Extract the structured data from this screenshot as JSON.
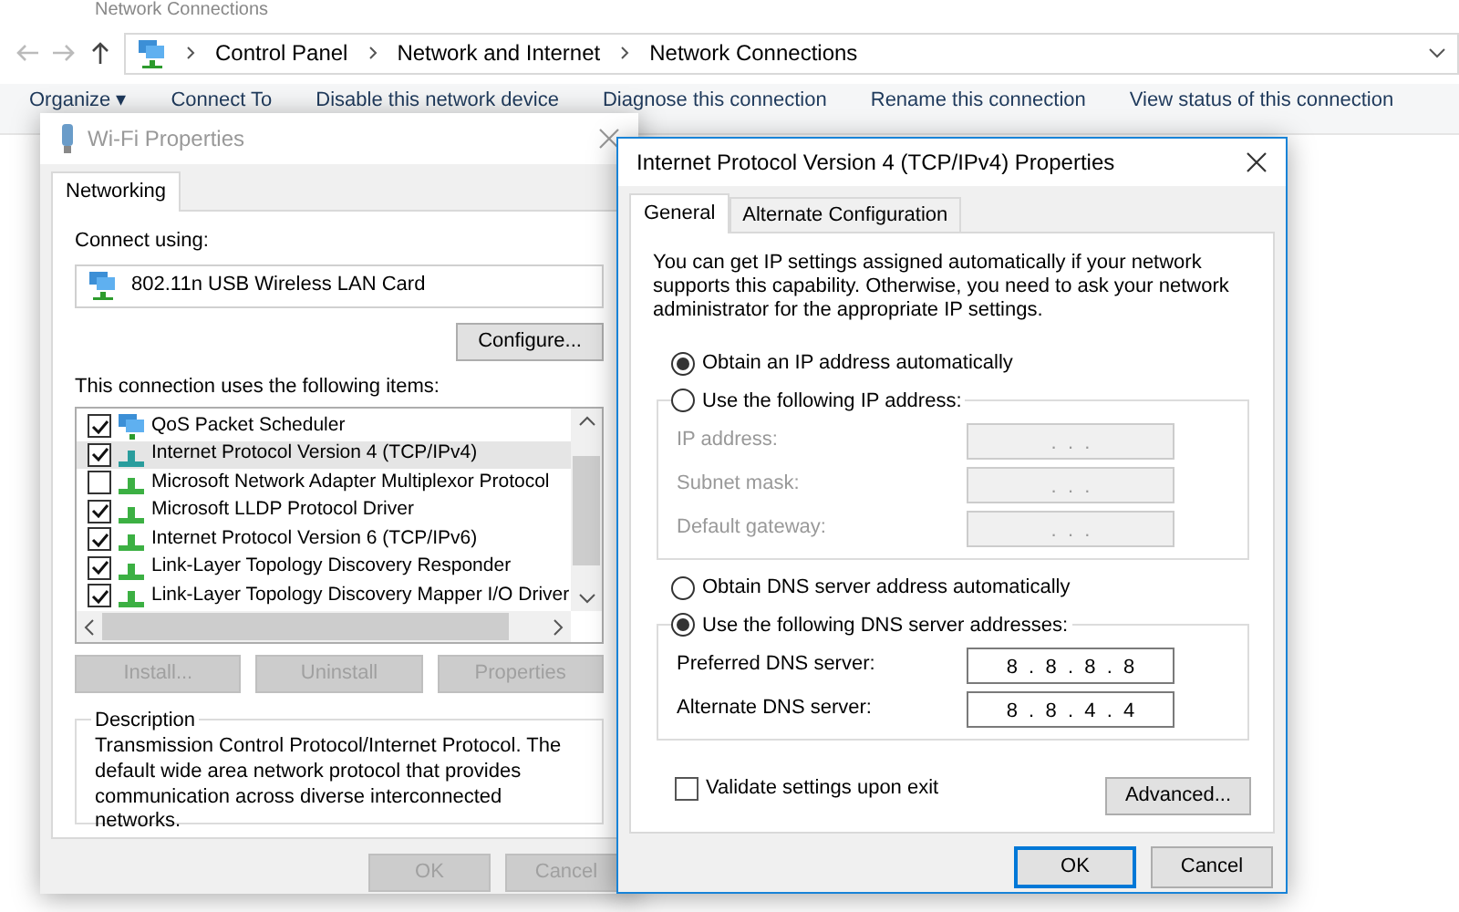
{
  "explorer": {
    "title": "Network Connections",
    "breadcrumb": [
      "Control Panel",
      "Network and Internet",
      "Network Connections"
    ],
    "toolbar": [
      "Organize ▾",
      "Connect To",
      "Disable this network device",
      "Diagnose this connection",
      "Rename this connection",
      "View status of this connection"
    ]
  },
  "wifi_dialog": {
    "title": "Wi-Fi Properties",
    "active": false,
    "tabs": [
      {
        "label": "Networking",
        "selected": true
      }
    ],
    "connect_using_label": "Connect using:",
    "adapter": "802.11n USB Wireless LAN Card",
    "configure_button": "Configure...",
    "items_label": "This connection uses the following items:",
    "items": [
      {
        "label": "QoS Packet Scheduler",
        "checked": true,
        "selected": false,
        "kind": "service"
      },
      {
        "label": "Internet Protocol Version 4 (TCP/IPv4)",
        "checked": true,
        "selected": true,
        "kind": "protocol"
      },
      {
        "label": "Microsoft Network Adapter Multiplexor Protocol",
        "checked": false,
        "selected": false,
        "kind": "protocol"
      },
      {
        "label": "Microsoft LLDP Protocol Driver",
        "checked": true,
        "selected": false,
        "kind": "protocol"
      },
      {
        "label": "Internet Protocol Version 6 (TCP/IPv6)",
        "checked": true,
        "selected": false,
        "kind": "protocol"
      },
      {
        "label": "Link-Layer Topology Discovery Responder",
        "checked": true,
        "selected": false,
        "kind": "protocol"
      },
      {
        "label": "Link-Layer Topology Discovery Mapper I/O Driver",
        "checked": true,
        "selected": false,
        "kind": "protocol"
      }
    ],
    "item_buttons": [
      {
        "label": "Install...",
        "disabled": true
      },
      {
        "label": "Uninstall",
        "disabled": true
      },
      {
        "label": "Properties",
        "disabled": true
      }
    ],
    "description_title": "Description",
    "description": "Transmission Control Protocol/Internet Protocol. The default wide area network protocol that provides communication across diverse interconnected networks.",
    "buttons": [
      {
        "label": "OK",
        "disabled": true
      },
      {
        "label": "Cancel",
        "disabled": true
      }
    ]
  },
  "ipv4_dialog": {
    "title": "Internet Protocol Version 4 (TCP/IPv4) Properties",
    "active": true,
    "tabs": [
      {
        "label": "General",
        "selected": true
      },
      {
        "label": "Alternate Configuration",
        "selected": false
      }
    ],
    "intro": "You can get IP settings assigned automatically if your network supports this capability. Otherwise, you need to ask your network administrator for the appropriate IP settings.",
    "ip_radios": [
      {
        "label": "Obtain an IP address automatically",
        "selected": true
      },
      {
        "label": "Use the following IP address:",
        "selected": false
      }
    ],
    "ip_fields": [
      {
        "label": "IP address:",
        "value": ".  .  .",
        "disabled": true
      },
      {
        "label": "Subnet mask:",
        "value": ".  .  .",
        "disabled": true
      },
      {
        "label": "Default gateway:",
        "value": ".  .  .",
        "disabled": true
      }
    ],
    "dns_radios": [
      {
        "label": "Obtain DNS server address automatically",
        "selected": false
      },
      {
        "label": "Use the following DNS server addresses:",
        "selected": true
      }
    ],
    "dns_fields": [
      {
        "label": "Preferred DNS server:",
        "value": "8  .  8  .  8  .  8",
        "disabled": false
      },
      {
        "label": "Alternate DNS server:",
        "value": "8  .  8  .  4  .  4",
        "disabled": false
      }
    ],
    "validate": {
      "label": "Validate settings upon exit",
      "checked": false
    },
    "advanced_button": "Advanced...",
    "buttons": [
      {
        "label": "OK",
        "default": true
      },
      {
        "label": "Cancel",
        "default": false
      }
    ]
  }
}
